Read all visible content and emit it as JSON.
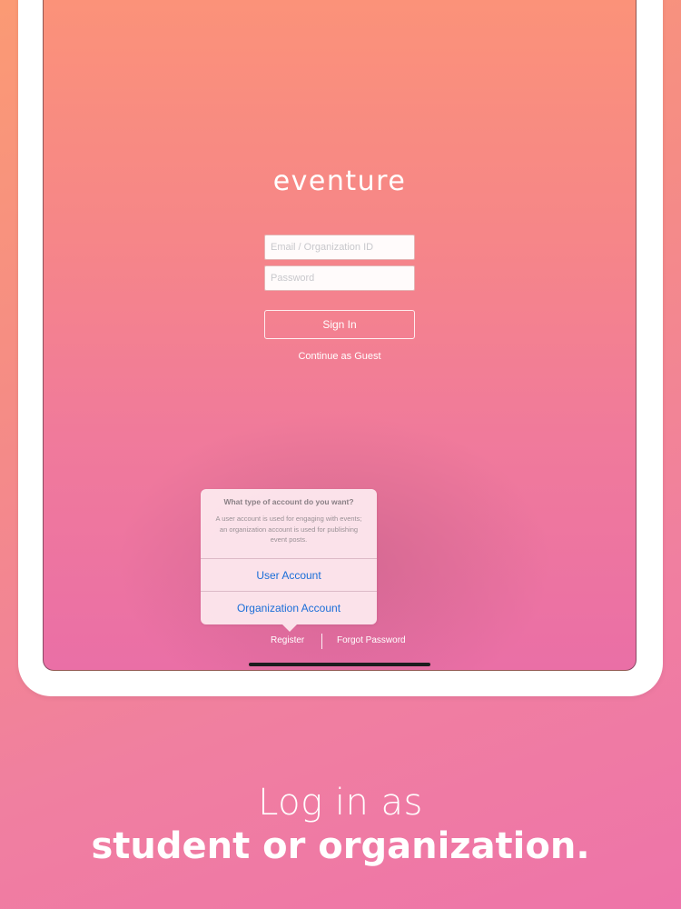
{
  "app": {
    "logo_text": "eventure"
  },
  "login_form": {
    "email_placeholder": "Email / Organization ID",
    "password_placeholder": "Password",
    "sign_in_label": "Sign In",
    "guest_label": "Continue as Guest"
  },
  "account_popover": {
    "title": "What type of account do you want?",
    "message": "A user account is used for engaging with events; an organization account is used for publishing event posts.",
    "actions": [
      {
        "label": "User Account"
      },
      {
        "label": "Organization Account"
      }
    ]
  },
  "footer_links": {
    "register_label": "Register",
    "forgot_password_label": "Forgot Password"
  },
  "caption": {
    "line1": "Log in as",
    "line2": "student or organization."
  },
  "colors": {
    "background_top": "#fb9a74",
    "background_bottom": "#ee74a9",
    "action_blue": "#1a6ed8"
  }
}
